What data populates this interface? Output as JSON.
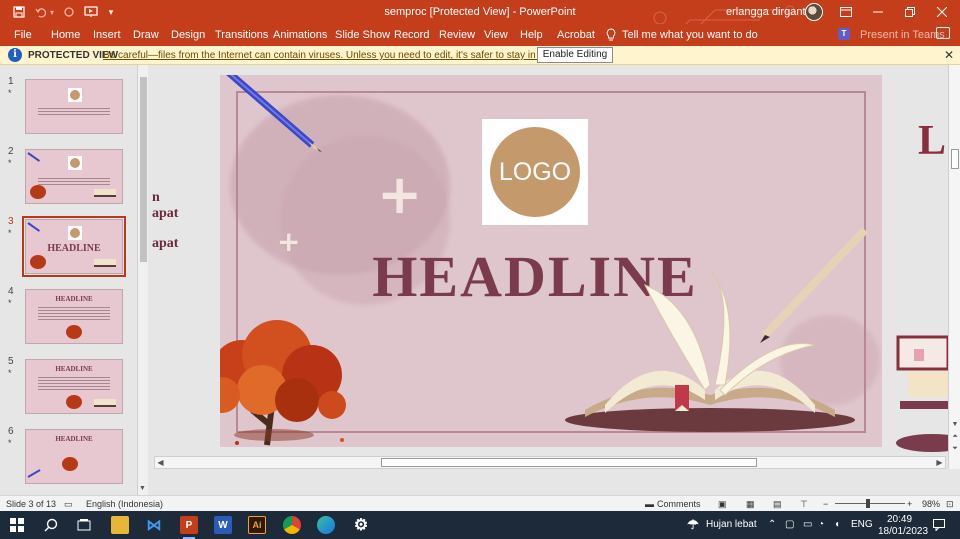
{
  "titlebar": {
    "doc_title": "semproc [Protected View] - PowerPoint",
    "user_name": "erlangga dirgantara",
    "icons": [
      "save-icon",
      "undo-icon",
      "redo-icon",
      "present-from-beginning-icon",
      "customize-qat-icon"
    ]
  },
  "ribbon": {
    "tabs": [
      "File",
      "Home",
      "Insert",
      "Draw",
      "Design",
      "Transitions",
      "Animations",
      "Slide Show",
      "Record",
      "Review",
      "View",
      "Help",
      "Acrobat"
    ],
    "tell_me": "Tell me what you want to do",
    "present_in_teams": "Present in Teams"
  },
  "protected_view": {
    "label": "PROTECTED VIEW",
    "message": "Be careful—files from the Internet can contain viruses. Unless you need to edit, it's safer to stay in Protected View.",
    "button": "Enable Editing"
  },
  "thumbnails": [
    {
      "number": "1",
      "star": "*",
      "headline": ""
    },
    {
      "number": "2",
      "star": "*",
      "headline": ""
    },
    {
      "number": "3",
      "star": "*",
      "headline": "HEADLINE",
      "selected": true
    },
    {
      "number": "4",
      "star": "*",
      "headline": "HEADLINE"
    },
    {
      "number": "5",
      "star": "*",
      "headline": "HEADLINE"
    },
    {
      "number": "6",
      "star": "*",
      "headline": "HEADLINE"
    }
  ],
  "slide": {
    "logo_text": "LOGO",
    "headline": "HEADLINE",
    "left_peek_1": "n",
    "left_peek_2": "apat",
    "left_peek_3": "apat",
    "right_peek": "L"
  },
  "statusbar": {
    "slide_info": "Slide 3 of 13",
    "language": "English (Indonesia)",
    "comments": "Comments",
    "zoom": "98%"
  },
  "taskbar": {
    "weather": "Hujan lebat",
    "lang": "ENG",
    "time": "20:49",
    "date": "18/01/2023"
  },
  "colors": {
    "accent": "#c43e1c",
    "slide_bg": "#dfc5cc",
    "headline": "#7a3b4d",
    "logo": "#c49a6c",
    "protected_bar": "#fff4ce"
  }
}
